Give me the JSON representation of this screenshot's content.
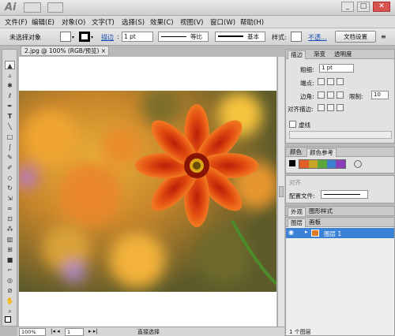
{
  "app": {
    "logo": "Ai",
    "window_buttons": [
      "_",
      "□",
      "✕"
    ]
  },
  "menu": [
    "文件(F)",
    "编辑(E)",
    "对象(O)",
    "文字(T)",
    "选择(S)",
    "效果(C)",
    "视图(V)",
    "窗口(W)",
    "帮助(H)"
  ],
  "control_bar": {
    "selection_label": "未选择对象",
    "stroke_link": "描边",
    "stroke_weight": "1 pt",
    "profile_label": "等比",
    "brush_label": "基本",
    "style_label": "样式:",
    "opacity_link": "不透...",
    "doc_setup": "文档设置"
  },
  "document_tab": {
    "title": "2.jpg @ 100% (RGB/预览)",
    "close": "×"
  },
  "tools": [
    "selection-icon",
    "direct-selection-icon",
    "magic-wand-icon",
    "lasso-icon",
    "pen-icon",
    "type-icon",
    "line-icon",
    "rectangle-icon",
    "paintbrush-icon",
    "pencil-icon",
    "blob-brush-icon",
    "eraser-icon",
    "rotate-icon",
    "scale-icon",
    "warp-icon",
    "free-transform-icon",
    "symbol-sprayer-icon",
    "graph-icon",
    "mesh-icon",
    "gradient-icon",
    "eyedropper-icon",
    "blend-icon",
    "slice-icon",
    "hand-icon",
    "zoom-icon",
    "fill-stroke-icon",
    "screen-mode-icon"
  ],
  "status_bar": {
    "zoom": "100%",
    "page": "1",
    "tool": "直接选择"
  },
  "stroke_panel": {
    "tabs": [
      "描边",
      "渐变",
      "透明度"
    ],
    "weight_label": "粗细:",
    "weight_value": "1 pt",
    "cap_label": "端点:",
    "corner_label": "边角:",
    "limit_label": "限制:",
    "limit_value": "10",
    "align_label": "对齐描边:",
    "dashed_label": "虚线"
  },
  "color_panel": {
    "tabs": [
      "颜色",
      "颜色参考"
    ],
    "swatch_colors": [
      "#e0602a",
      "#c8a428",
      "#5aa83c",
      "#3a7fd0",
      "#8a3fb8",
      "#c0c0c0"
    ]
  },
  "config_panel": {
    "label": "对齐",
    "config_label": "配置文件:"
  },
  "appearance_tabs": [
    "外观",
    "图形样式"
  ],
  "layers_panel": {
    "tabs": [
      "图层",
      "画板"
    ],
    "layer_name": "图层 1",
    "footer": "1 个图层"
  }
}
